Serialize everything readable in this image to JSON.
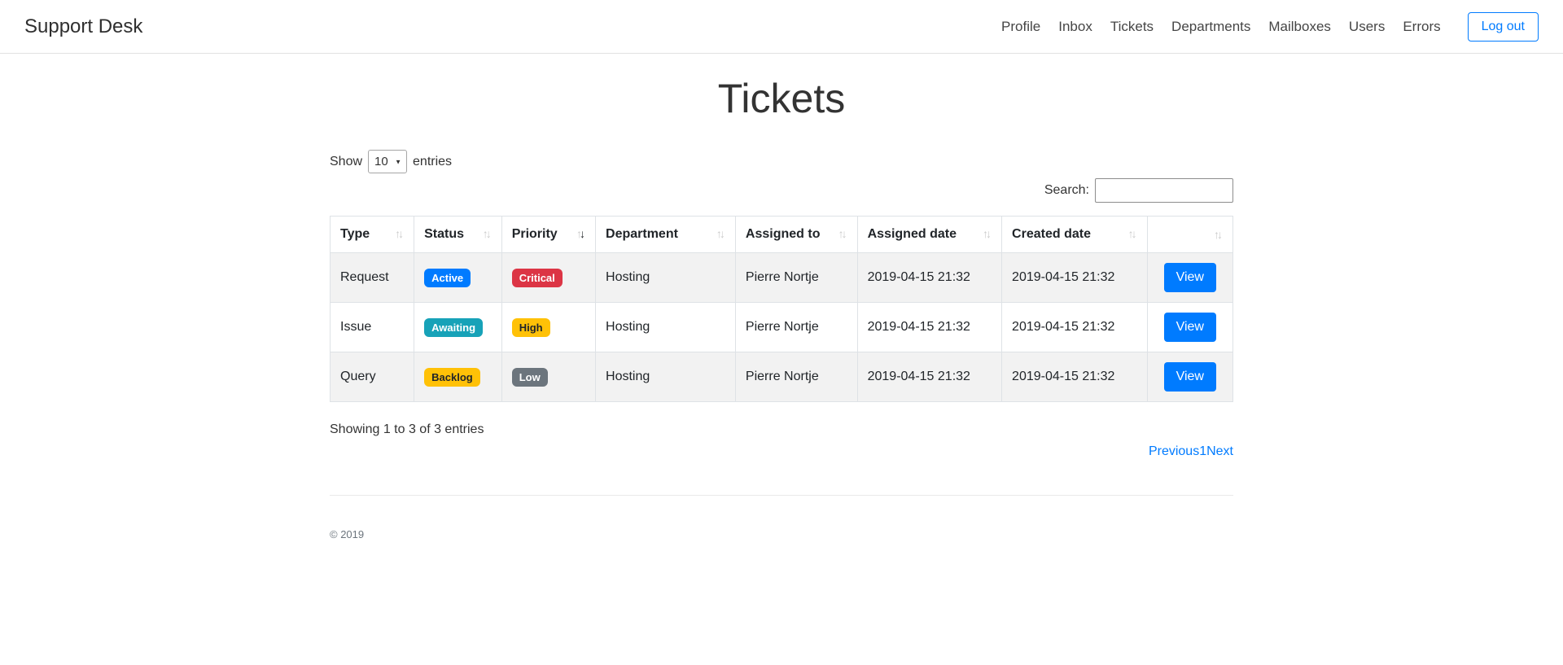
{
  "navbar": {
    "brand": "Support Desk",
    "items": [
      "Profile",
      "Inbox",
      "Tickets",
      "Departments",
      "Mailboxes",
      "Users",
      "Errors"
    ],
    "logout_label": "Log out"
  },
  "page": {
    "title": "Tickets"
  },
  "controls": {
    "show_label": "Show",
    "page_size": "10",
    "entries_label": "entries",
    "search_label": "Search:",
    "search_value": ""
  },
  "icons": {
    "sort_asc": "↑",
    "sort_desc": "↓",
    "select_caret": "▼"
  },
  "table": {
    "columns": [
      {
        "label": "Type",
        "sort": "none"
      },
      {
        "label": "Status",
        "sort": "none"
      },
      {
        "label": "Priority",
        "sort": "desc"
      },
      {
        "label": "Department",
        "sort": "none"
      },
      {
        "label": "Assigned to",
        "sort": "none"
      },
      {
        "label": "Assigned date",
        "sort": "none"
      },
      {
        "label": "Created date",
        "sort": "none"
      },
      {
        "label": "",
        "sort": "none"
      }
    ],
    "rows": [
      {
        "type": "Request",
        "status": {
          "label": "Active",
          "bg": "#007bff",
          "fg": "#ffffff"
        },
        "priority": {
          "label": "Critical",
          "bg": "#dc3545",
          "fg": "#ffffff"
        },
        "department": "Hosting",
        "assigned_to": "Pierre Nortje",
        "assigned_date": "2019-04-15 21:32",
        "created_date": "2019-04-15 21:32",
        "action": "View"
      },
      {
        "type": "Issue",
        "status": {
          "label": "Awaiting",
          "bg": "#17a2b8",
          "fg": "#ffffff"
        },
        "priority": {
          "label": "High",
          "bg": "#ffc107",
          "fg": "#212529"
        },
        "department": "Hosting",
        "assigned_to": "Pierre Nortje",
        "assigned_date": "2019-04-15 21:32",
        "created_date": "2019-04-15 21:32",
        "action": "View"
      },
      {
        "type": "Query",
        "status": {
          "label": "Backlog",
          "bg": "#ffc107",
          "fg": "#212529"
        },
        "priority": {
          "label": "Low",
          "bg": "#6c757d",
          "fg": "#ffffff"
        },
        "department": "Hosting",
        "assigned_to": "Pierre Nortje",
        "assigned_date": "2019-04-15 21:32",
        "created_date": "2019-04-15 21:32",
        "action": "View"
      }
    ]
  },
  "summary": "Showing 1 to 3 of 3 entries",
  "pagination": {
    "previous": "Previous",
    "page": "1",
    "next": "Next"
  },
  "footer": {
    "copyright": "© 2019"
  },
  "colors": {
    "accent": "#007bff",
    "danger": "#dc3545",
    "info": "#17a2b8",
    "warning": "#ffc107",
    "secondary": "#6c757d",
    "row_stripe": "#f2f2f2",
    "table_border": "#dee2e6"
  }
}
